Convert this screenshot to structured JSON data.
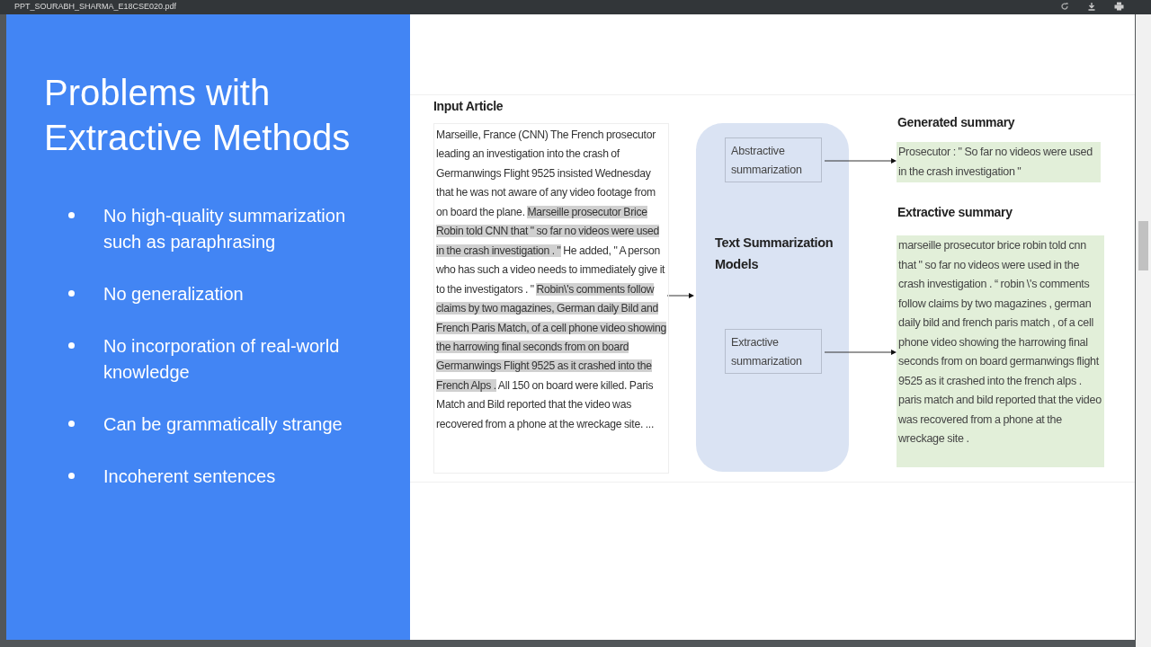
{
  "viewer": {
    "title": "PPT_SOURABH_SHARMA_E18CSE020.pdf"
  },
  "slide": {
    "title": "Problems with Extractive Methods",
    "bullets": [
      "No high-quality summarization such as paraphrasing",
      "No generalization",
      "No incorporation of real-world knowledge",
      "Can be grammatically strange",
      "Incoherent sentences"
    ]
  },
  "figure": {
    "input_title": "Input Article",
    "article": [
      {
        "text": "Marseille, France (CNN) The French prosecutor leading an investigation into the crash of Germanwings Flight 9525 insisted Wednesday that he was not aware of any video footage from on board the plane. ",
        "highlighted": false
      },
      {
        "text": "Marseille prosecutor Brice Robin told CNN that \" so far no videos were used in the crash investigation . \"",
        "highlighted": true
      },
      {
        "text": " He added, \" A person who has such a video needs to immediately give it to the investigators . \" ",
        "highlighted": false
      },
      {
        "text": "Robin\\'s comments follow claims by two magazines, German daily Bild and French Paris Match, of a cell phone video showing the harrowing final seconds from on board Germanwings Flight 9525 as it crashed into the French Alps .",
        "highlighted": true
      },
      {
        "text": " All 150 on board were killed. Paris Match and Bild reported that the video was recovered from a phone at the wreckage site. ...",
        "highlighted": false
      }
    ],
    "models_title": "Text Summarization Models",
    "methods": [
      "Abstractive summarization",
      "Extractive summarization"
    ],
    "summaries": [
      {
        "title": "Generated summary",
        "text": "Prosecutor : \" So far no videos were used in the crash investigation \""
      },
      {
        "title": "Extractive summary",
        "text": "marseille prosecutor brice robin told cnn that \" so far no videos were used in the crash investigation . “ robin \\'s comments follow claims by two magazines , german daily bild and french paris match , of a cell phone video showing the harrowing final seconds from on board germanwings flight 9525 as it crashed into the french alps . paris match and bild reported that the video was recovered from a phone at the wreckage site ."
      }
    ]
  }
}
